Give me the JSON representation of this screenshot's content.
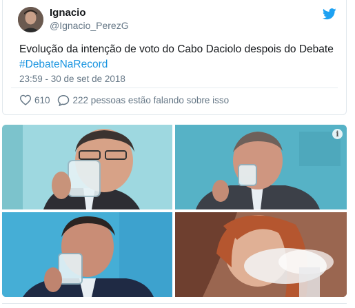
{
  "tweet": {
    "display_name": "Ignacio",
    "handle": "@Ignacio_PerezG",
    "text_main": "Evolução da intenção de voto do Cabo Daciolo despois do Debate ",
    "hashtag": "#DebateNaRecord",
    "timestamp": "23:59 - 30 de set de 2018",
    "like_count": "610",
    "conversation_text": "222 pessoas estão falando sobre isso"
  },
  "icons": {
    "brand": "twitter-bird-icon",
    "like": "heart-icon",
    "reply": "speech-bubble-icon",
    "info": "info-icon"
  },
  "colors": {
    "link": "#1b95e0",
    "secondary_text": "#657786",
    "twitter_blue": "#1da1f2"
  },
  "media": {
    "info_glyph": "i"
  }
}
